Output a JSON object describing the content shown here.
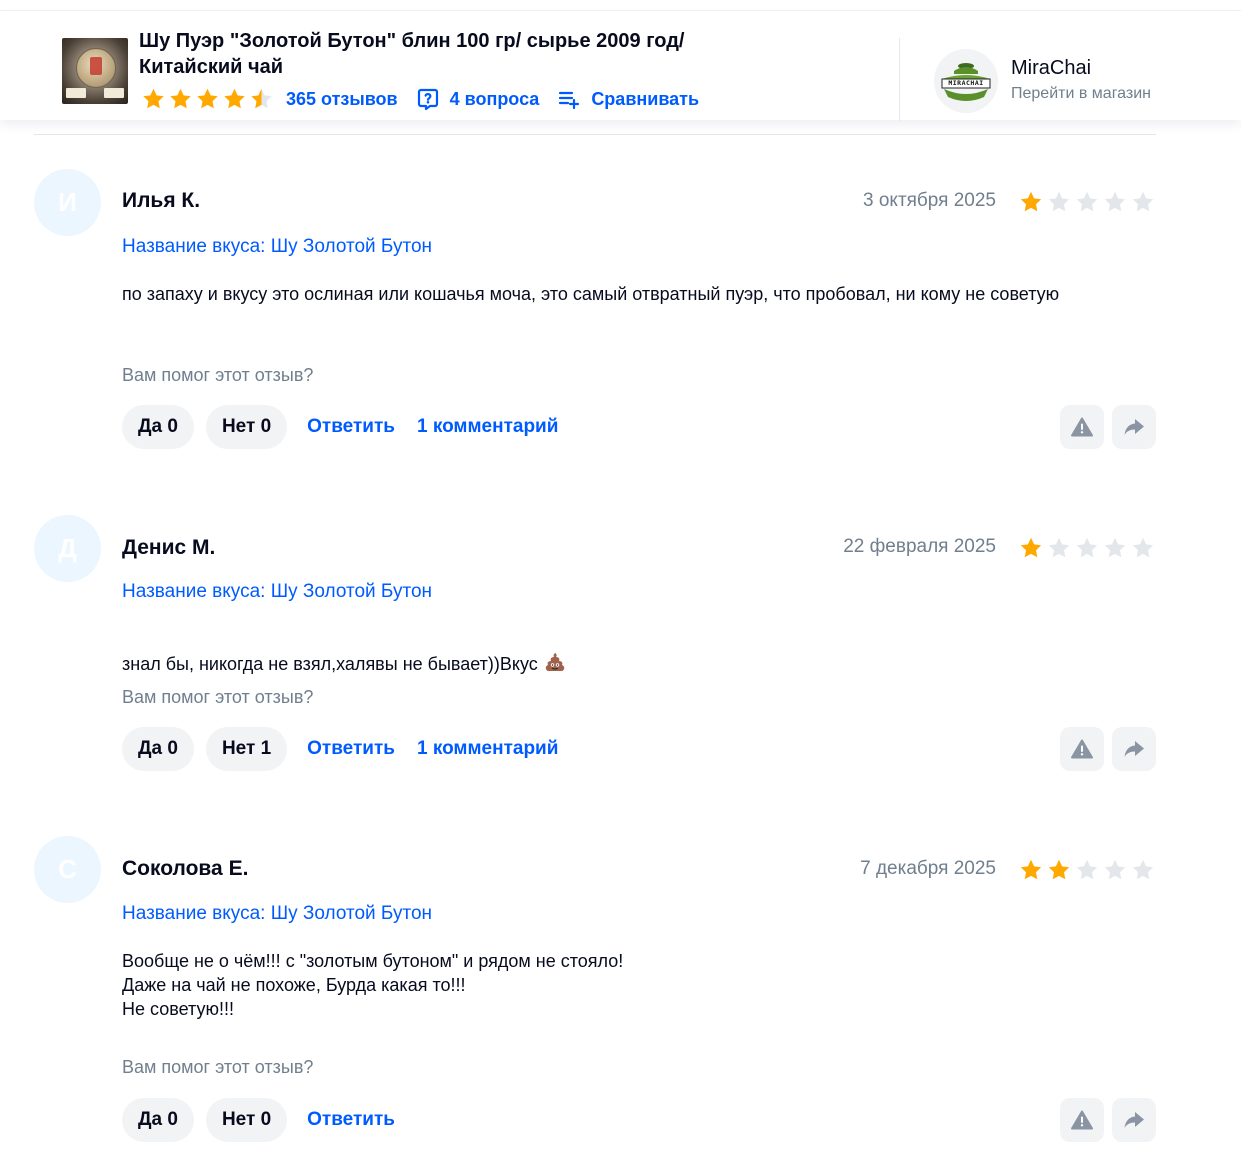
{
  "header": {
    "product_title": "Шу Пуэр \"Золотой Бутон\" блин 100 гр/ сырье 2009 год/ Китайский чай",
    "rating_stars": 4.5,
    "reviews_link": "365 отзывов",
    "questions_link": "4 вопроса",
    "compare_link": "Сравнивать",
    "shop_name": "MiraChai",
    "shop_subtitle": "Перейти в магазин",
    "shop_logo_text": "MIRACHAI"
  },
  "colors": {
    "accent": "#005bff",
    "star_filled": "#ffa800",
    "star_empty": "#e3e6eb",
    "muted_text": "#707f8d",
    "pill_bg": "#f2f3f5",
    "avatar_bg": "#ecf6ff"
  },
  "reviews": [
    {
      "initial": "И",
      "author": "Илья К.",
      "date": "3 октября 2025",
      "rating": 1,
      "flavor": "Название вкуса: Шу Золотой Бутон",
      "text": "по запаху и вкусу это ослиная или кошачья моча, это самый отвратный пуэр, что пробовал, ни кому не советую",
      "helpful_q": "Вам помог этот отзыв?",
      "yes": "Да 0",
      "no": "Нет 0",
      "reply": "Ответить",
      "comments": "1 комментарий"
    },
    {
      "initial": "Д",
      "author": "Денис М.",
      "date": "22 февраля 2025",
      "rating": 1,
      "flavor": "Название вкуса: Шу Золотой Бутон",
      "text": "знал бы, никогда не взял,халявы не бывает))Вкус",
      "emoji": "pile-of-poo-icon",
      "helpful_q": "Вам помог этот отзыв?",
      "yes": "Да 0",
      "no": "Нет 1",
      "reply": "Ответить",
      "comments": "1 комментарий"
    },
    {
      "initial": "С",
      "author": "Соколова Е.",
      "date": "7 декабря 2025",
      "rating": 2,
      "flavor": "Название вкуса: Шу Золотой Бутон",
      "text": "Вообще не о чём!!! с \"золотым бутоном\" и рядом не стояло!\nДаже на чай не похоже, Бурда какая то!!!\nНе советую!!!",
      "helpful_q": "Вам помог этот отзыв?",
      "yes": "Да 0",
      "no": "Нет 0",
      "reply": "Ответить"
    }
  ],
  "icons": {
    "report": "warning-triangle-icon",
    "share": "share-arrow-icon",
    "questions": "question-bubble-icon",
    "compare": "compare-list-icon"
  }
}
